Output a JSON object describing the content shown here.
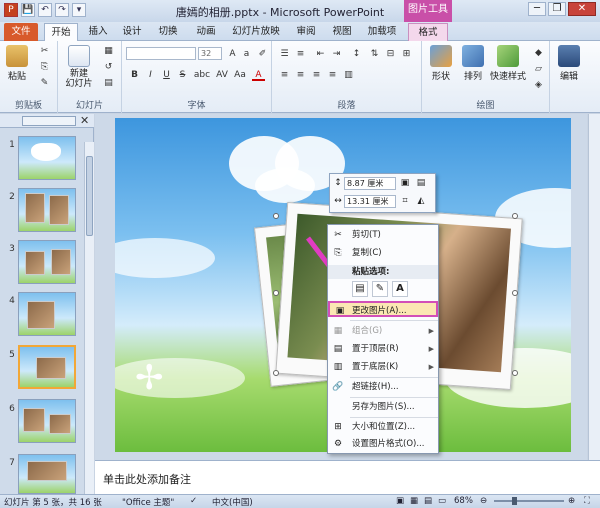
{
  "window": {
    "title": "唐嫣的相册.pptx - Microsoft PowerPoint",
    "context_group": "图片工具"
  },
  "qat": {
    "app_icon": "P",
    "save": "💾",
    "undo": "↶",
    "redo": "↷",
    "customize": "▾"
  },
  "window_controls": {
    "minimize": "─",
    "restore": "❐",
    "close": "✕"
  },
  "tabs": [
    "文件",
    "开始",
    "插入",
    "设计",
    "切换",
    "动画",
    "幻灯片放映",
    "审阅",
    "视图",
    "加载项",
    "格式"
  ],
  "ribbon": {
    "clipboard": {
      "label": "剪贴板",
      "paste": "粘贴"
    },
    "slides": {
      "label": "幻灯片",
      "new_slide": "新建\n幻灯片"
    },
    "font": {
      "label": "字体",
      "font_name": "",
      "font_size": "32",
      "bold": "B",
      "italic": "I",
      "underline": "U",
      "strike": "S",
      "shadow": "abc",
      "spacing": "AV",
      "case": "Aa",
      "color": "A"
    },
    "paragraph": {
      "label": "段落"
    },
    "drawing": {
      "label": "绘图",
      "shapes": "形状",
      "arrange": "排列",
      "quick_styles": "快速样式"
    },
    "editing": {
      "label": "",
      "edit": "编辑"
    }
  },
  "slides_pane": {
    "numbers": [
      "1",
      "2",
      "3",
      "4",
      "5",
      "6",
      "7"
    ],
    "selected": 5,
    "close": "✕"
  },
  "mini_toolbar": {
    "height": "8.87 厘米",
    "width": "13.31 厘米"
  },
  "context_menu": {
    "items": [
      {
        "label": "剪切(T)",
        "icon": "✂",
        "disabled": false
      },
      {
        "label": "复制(C)",
        "icon": "⎘",
        "disabled": false
      },
      {
        "label": "粘贴选项:",
        "icon": "",
        "disabled": false
      },
      {
        "label": "更改图片(A)...",
        "icon": "▣",
        "disabled": false
      },
      {
        "label": "组合(G)",
        "icon": "▦",
        "disabled": true
      },
      {
        "label": "置于顶层(R)",
        "icon": "▤",
        "disabled": false
      },
      {
        "label": "置于底层(K)",
        "icon": "▥",
        "disabled": false
      },
      {
        "label": "超链接(H)...",
        "icon": "🔗",
        "disabled": false
      },
      {
        "label": "另存为图片(S)...",
        "icon": "",
        "disabled": false
      },
      {
        "label": "大小和位置(Z)...",
        "icon": "⊞",
        "disabled": false
      },
      {
        "label": "设置图片格式(O)...",
        "icon": "⚙",
        "disabled": false
      }
    ],
    "paste_buttons": [
      "▤",
      "✎",
      "A"
    ]
  },
  "notes": {
    "placeholder": "单击此处添加备注"
  },
  "status": {
    "slide_info": "幻灯片 第 5 张，共 16 张",
    "theme": "\"Office 主题\"",
    "language": "中文(中国)",
    "zoom": "68%"
  },
  "colors": {
    "file_tab": "#d85a2b",
    "context_tab": "#c94fa8",
    "highlight": "#d24fb8",
    "selected_thumb": "#f2a737"
  }
}
